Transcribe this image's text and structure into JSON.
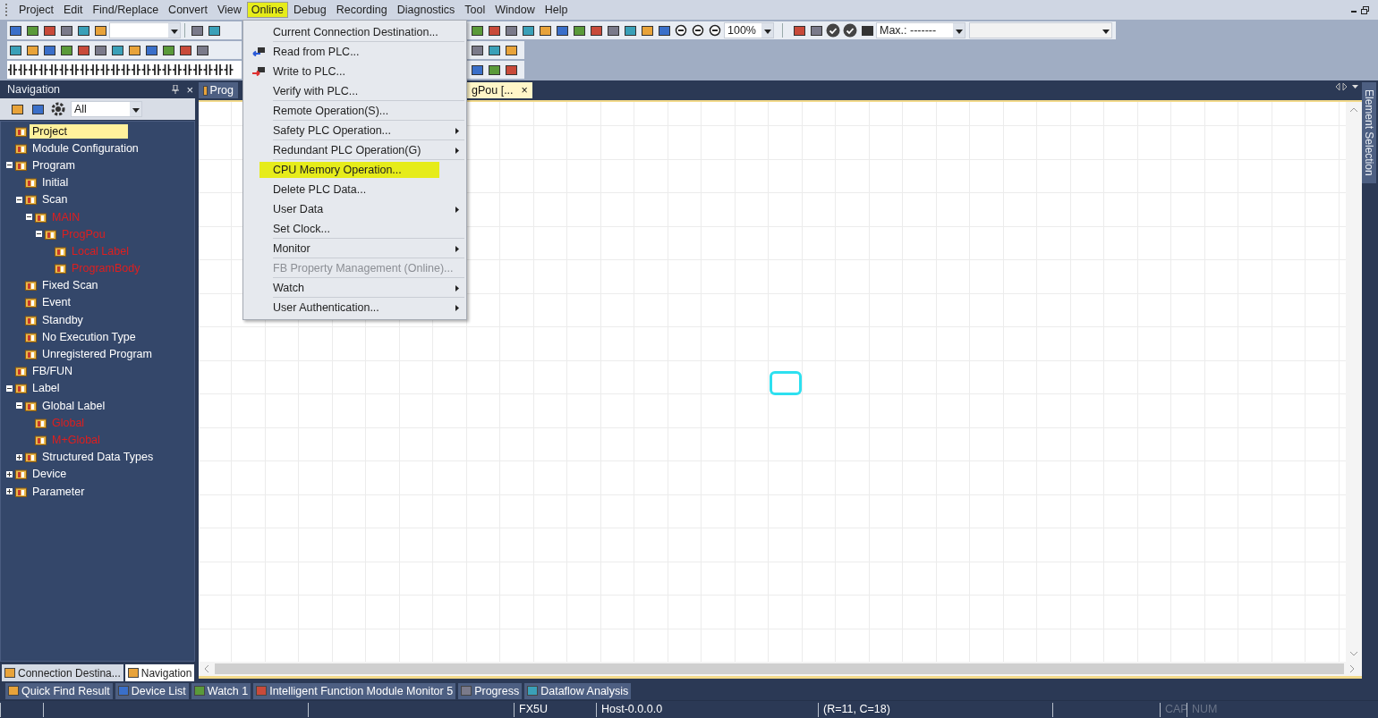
{
  "menu_bar": [
    {
      "label": "Project",
      "selected": false
    },
    {
      "label": "Edit",
      "selected": false
    },
    {
      "label": "Find/Replace",
      "selected": false
    },
    {
      "label": "Convert",
      "selected": false
    },
    {
      "label": "View",
      "selected": false
    },
    {
      "label": "Online",
      "selected": true
    },
    {
      "label": "Debug",
      "selected": false
    },
    {
      "label": "Recording",
      "selected": false
    },
    {
      "label": "Diagnostics",
      "selected": false
    },
    {
      "label": "Tool",
      "selected": false
    },
    {
      "label": "Window",
      "selected": false
    },
    {
      "label": "Help",
      "selected": false
    }
  ],
  "toolbar": {
    "zoom": "100%",
    "max_field": "Max.: -------"
  },
  "online_menu": [
    {
      "label": "Current Connection Destination...",
      "kind": "plain",
      "submenu": false,
      "disabled": false,
      "selected": false,
      "separator_after": true
    },
    {
      "label": "Read from PLC...",
      "kind": "read",
      "submenu": false,
      "disabled": false,
      "selected": false,
      "separator_after": false
    },
    {
      "label": "Write to PLC...",
      "kind": "write",
      "submenu": false,
      "disabled": false,
      "selected": false,
      "separator_after": false
    },
    {
      "label": "Verify with PLC...",
      "kind": "plain",
      "submenu": false,
      "disabled": false,
      "selected": false,
      "separator_after": true
    },
    {
      "label": "Remote Operation(S)...",
      "kind": "plain",
      "submenu": false,
      "disabled": false,
      "selected": false,
      "separator_after": true
    },
    {
      "label": "Safety PLC Operation...",
      "kind": "plain",
      "submenu": true,
      "disabled": false,
      "selected": false,
      "separator_after": true
    },
    {
      "label": "Redundant PLC Operation(G)",
      "kind": "plain",
      "submenu": true,
      "disabled": false,
      "selected": false,
      "separator_after": true
    },
    {
      "label": "CPU Memory Operation...",
      "kind": "plain",
      "submenu": false,
      "disabled": false,
      "selected": true,
      "separator_after": false
    },
    {
      "label": "Delete PLC Data...",
      "kind": "plain",
      "submenu": false,
      "disabled": false,
      "selected": false,
      "separator_after": false
    },
    {
      "label": "User Data",
      "kind": "plain",
      "submenu": true,
      "disabled": false,
      "selected": false,
      "separator_after": false
    },
    {
      "label": "Set Clock...",
      "kind": "plain",
      "submenu": false,
      "disabled": false,
      "selected": false,
      "separator_after": true
    },
    {
      "label": "Monitor",
      "kind": "plain",
      "submenu": true,
      "disabled": false,
      "selected": false,
      "separator_after": true
    },
    {
      "label": "FB Property Management (Online)...",
      "kind": "plain",
      "submenu": false,
      "disabled": true,
      "selected": false,
      "separator_after": true
    },
    {
      "label": "Watch",
      "kind": "plain",
      "submenu": true,
      "disabled": false,
      "selected": false,
      "separator_after": true
    },
    {
      "label": "User Authentication...",
      "kind": "plain",
      "submenu": true,
      "disabled": false,
      "selected": false,
      "separator_after": false
    }
  ],
  "navigation": {
    "title": "Navigation",
    "close": "×",
    "filter": "All",
    "tree": [
      {
        "label": "Project",
        "selected": true,
        "modified": false
      },
      {
        "label": "Module Configuration",
        "selected": false,
        "modified": false
      },
      {
        "label": "Program",
        "selected": false,
        "modified": false,
        "expanded": true,
        "children": [
          {
            "label": "Initial",
            "selected": false,
            "modified": false
          },
          {
            "label": "Scan",
            "selected": false,
            "modified": false,
            "expanded": true,
            "children": [
              {
                "label": "MAIN",
                "selected": false,
                "modified": true,
                "expanded": true,
                "children": [
                  {
                    "label": "ProgPou",
                    "selected": false,
                    "modified": true,
                    "expanded": true,
                    "children": [
                      {
                        "label": "Local Label",
                        "selected": false,
                        "modified": true
                      },
                      {
                        "label": "ProgramBody",
                        "selected": false,
                        "modified": true
                      }
                    ]
                  }
                ]
              }
            ]
          },
          {
            "label": "Fixed Scan",
            "selected": false,
            "modified": false
          },
          {
            "label": "Event",
            "selected": false,
            "modified": false
          },
          {
            "label": "Standby",
            "selected": false,
            "modified": false
          },
          {
            "label": "No Execution Type",
            "selected": false,
            "modified": false
          },
          {
            "label": "Unregistered Program",
            "selected": false,
            "modified": false
          }
        ]
      },
      {
        "label": "FB/FUN",
        "selected": false,
        "modified": false
      },
      {
        "label": "Label",
        "selected": false,
        "modified": false,
        "expanded": true,
        "children": [
          {
            "label": "Global Label",
            "selected": false,
            "modified": false,
            "expanded": true,
            "children": [
              {
                "label": "Global",
                "selected": false,
                "modified": true
              },
              {
                "label": "M+Global",
                "selected": false,
                "modified": true
              }
            ]
          },
          {
            "label": "Structured Data Types",
            "selected": false,
            "modified": false,
            "expanded": false
          }
        ]
      },
      {
        "label": "Device",
        "selected": false,
        "modified": false,
        "expanded": false
      },
      {
        "label": "Parameter",
        "selected": false,
        "modified": false,
        "expanded": false
      }
    ]
  },
  "editor_tabs": [
    {
      "label": "Prog",
      "selected": false
    },
    {
      "label": "gPou [...",
      "selected": true,
      "close": "×"
    }
  ],
  "side_panel": {
    "title": "Element Selection"
  },
  "panel_tabs": [
    {
      "label": "Connection Destina...",
      "selected": false
    },
    {
      "label": "Navigation",
      "selected": true
    }
  ],
  "docked_tabs": [
    {
      "label": "Quick Find Result"
    },
    {
      "label": "Device List"
    },
    {
      "label": "Watch 1"
    },
    {
      "label": "Intelligent Function Module Monitor 5"
    },
    {
      "label": "Progress"
    },
    {
      "label": "Dataflow Analysis"
    }
  ],
  "status_bar": [
    {
      "label": "FX5U",
      "disabled": false
    },
    {
      "label": "Host-0.0.0.0",
      "disabled": false
    },
    {
      "label": "(R=11, C=18)",
      "disabled": false
    },
    {
      "label": "CAP",
      "disabled": true
    },
    {
      "label": "NUM",
      "disabled": true
    }
  ]
}
